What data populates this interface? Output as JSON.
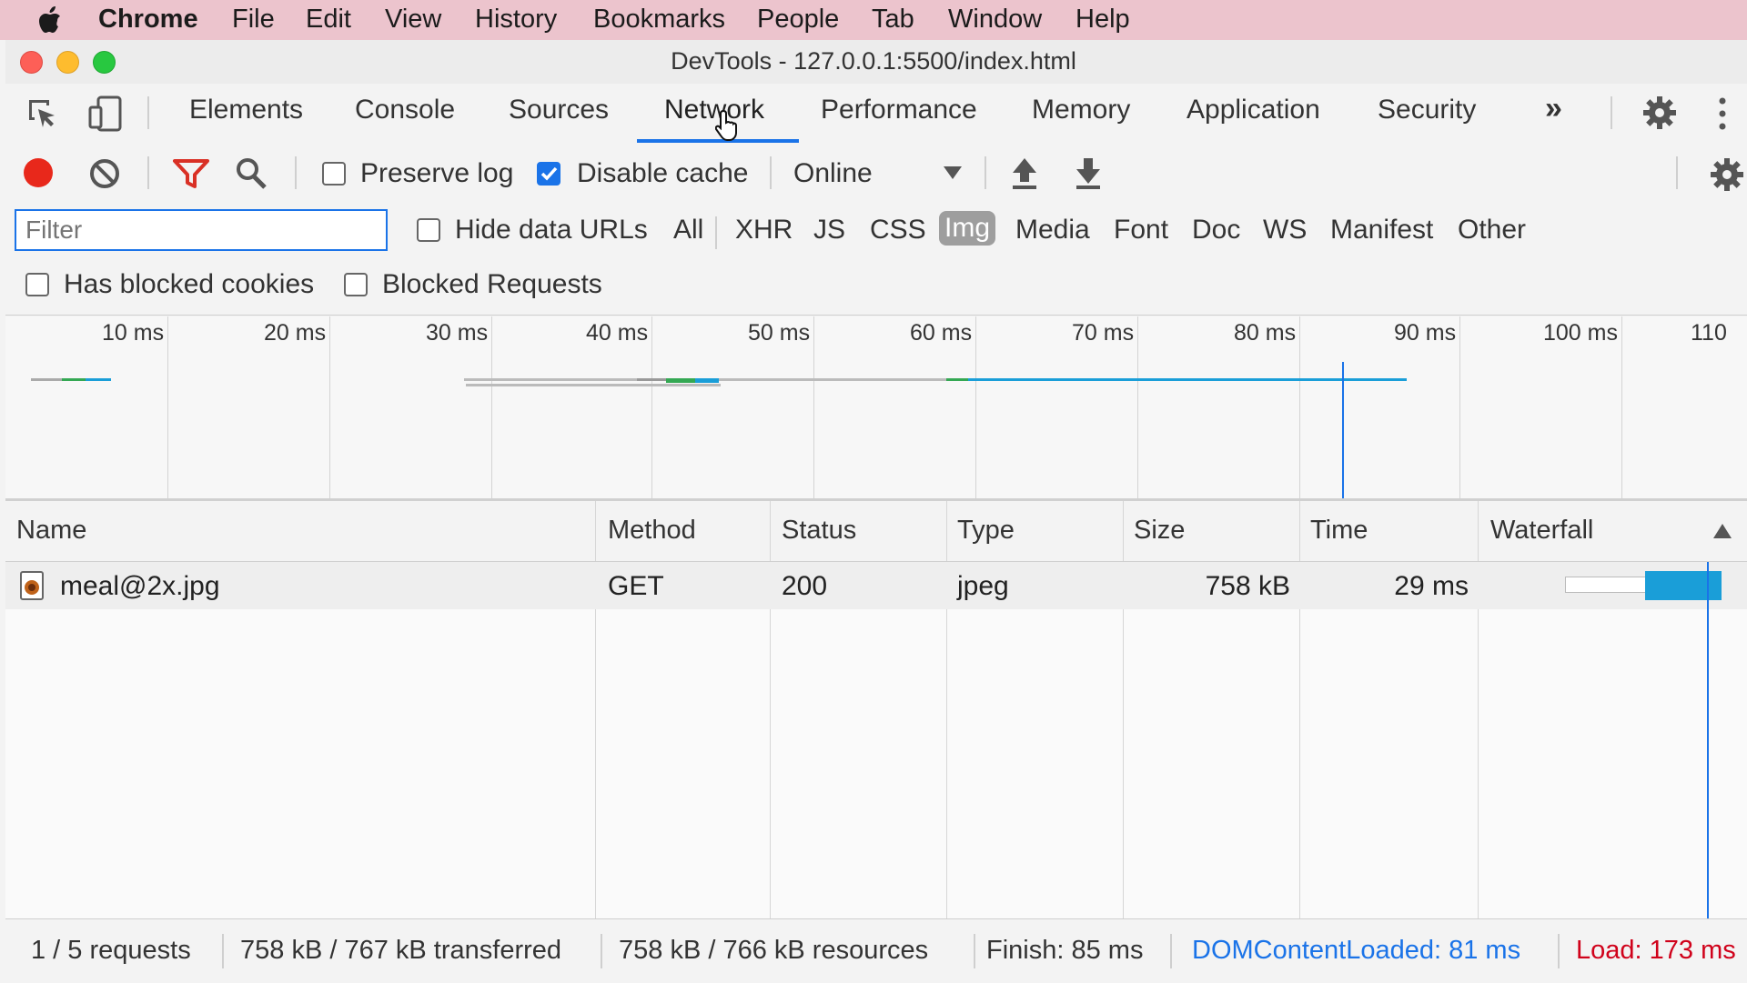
{
  "menubar": {
    "app_name": "Chrome",
    "items": [
      "File",
      "Edit",
      "View",
      "History",
      "Bookmarks",
      "People",
      "Tab",
      "Window",
      "Help"
    ]
  },
  "window": {
    "title": "DevTools - 127.0.0.1:5500/index.html"
  },
  "tabs": {
    "items": [
      "Elements",
      "Console",
      "Sources",
      "Network",
      "Performance",
      "Memory",
      "Application",
      "Security"
    ],
    "active": "Network",
    "more_label": "»"
  },
  "toolbar": {
    "preserve_log_label": "Preserve log",
    "preserve_log_checked": false,
    "disable_cache_label": "Disable cache",
    "disable_cache_checked": true,
    "throttle_value": "Online"
  },
  "filter": {
    "placeholder": "Filter",
    "hide_data_urls_label": "Hide data URLs",
    "types": [
      "All",
      "XHR",
      "JS",
      "CSS",
      "Img",
      "Media",
      "Font",
      "Doc",
      "WS",
      "Manifest",
      "Other"
    ],
    "active_type": "Img",
    "has_blocked_cookies_label": "Has blocked cookies",
    "blocked_requests_label": "Blocked Requests"
  },
  "overview": {
    "ticks": [
      "10 ms",
      "20 ms",
      "30 ms",
      "40 ms",
      "50 ms",
      "60 ms",
      "70 ms",
      "80 ms",
      "90 ms",
      "100 ms",
      "110"
    ]
  },
  "table": {
    "headers": [
      "Name",
      "Method",
      "Status",
      "Type",
      "Size",
      "Time",
      "Waterfall"
    ],
    "rows": [
      {
        "name": "meal@2x.jpg",
        "method": "GET",
        "status": "200",
        "type": "jpeg",
        "size": "758 kB",
        "time": "29 ms"
      }
    ]
  },
  "status": {
    "requests": "1 / 5 requests",
    "transferred": "758 kB / 767 kB transferred",
    "resources": "758 kB / 766 kB resources",
    "finish": "Finish: 85 ms",
    "dom_content_loaded": "DOMContentLoaded: 81 ms",
    "load": "Load: 173 ms"
  },
  "colors": {
    "accent": "#1a73e8",
    "record": "#e8281b",
    "load": "#d0021b",
    "dcl": "#1a73e8"
  }
}
